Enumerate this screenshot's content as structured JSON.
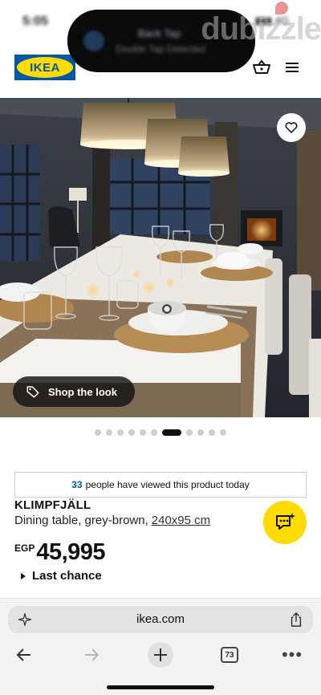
{
  "status": {
    "time": "5:05",
    "signal": "▮▮▮ 4G"
  },
  "island": {
    "title": "Back Tap",
    "subtitle": "Double Tap Detected"
  },
  "watermark": "dubizzle",
  "header": {
    "logo_text": "IKEA"
  },
  "hero": {
    "shop_label": "Shop the look",
    "dot_count": 11,
    "active_dot": 6
  },
  "product": {
    "viewed_count": "33",
    "viewed_text": "people have viewed this product today",
    "name": "KLIMPFJÄLL",
    "description": "Dining table, grey-brown,",
    "size": "240x95 cm",
    "currency": "EGP",
    "price": "45,995",
    "status": "Last chance"
  },
  "browser": {
    "url": "ikea.com",
    "tab_count": "73"
  },
  "colors": {
    "ikea_blue": "#0058a3",
    "ikea_yellow": "#ffdb00"
  }
}
